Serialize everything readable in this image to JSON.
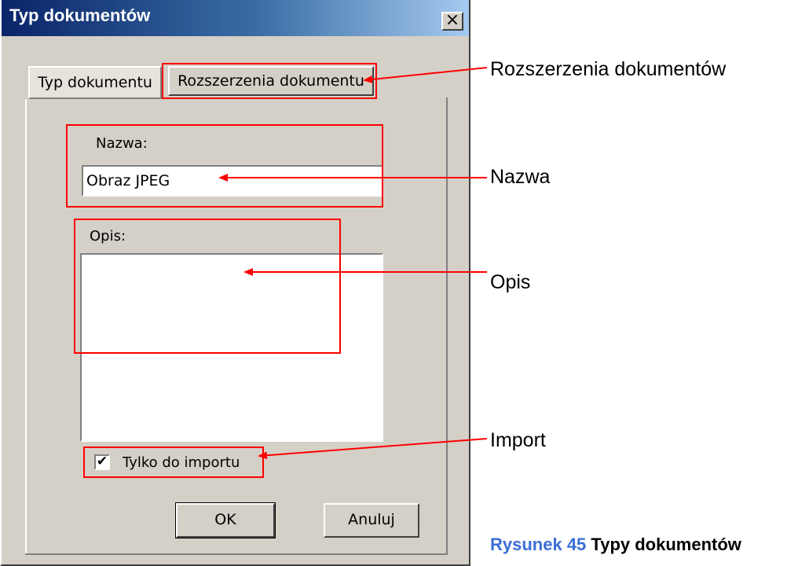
{
  "dialog": {
    "title": "Typ dokumentów",
    "close_label": "×",
    "tabs": [
      {
        "label": "Typ dokumentu",
        "active": true
      },
      {
        "label": "Rozszerzenia dokumentu",
        "active": false
      }
    ],
    "name_label": "Nazwa:",
    "name_value": "Obraz JPEG",
    "description_label": "Opis:",
    "description_value": "",
    "import_checkbox": {
      "label": "Tylko do importu",
      "checked": true,
      "check_glyph": "✔"
    },
    "ok_label": "OK",
    "cancel_label": "Anuluj"
  },
  "annotations": {
    "extensions": "Rozszerzenia dokumentów",
    "name": "Nazwa",
    "description": "Opis",
    "import": "Import",
    "highlight_color": "#ff0000"
  },
  "caption": {
    "number": "Rysunek 45",
    "text": " Typy dokumentów",
    "number_color": "#3b6fd6"
  }
}
